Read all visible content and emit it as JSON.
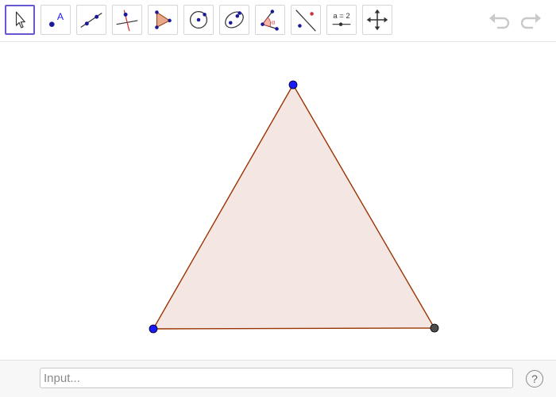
{
  "toolbar": {
    "tools": [
      {
        "name": "move-tool",
        "icon": "arrow-pointer-icon",
        "selected": true
      },
      {
        "name": "point-tool",
        "icon": "point-icon",
        "label": "A"
      },
      {
        "name": "line-tool",
        "icon": "line-icon"
      },
      {
        "name": "perpendicular-line-tool",
        "icon": "perpendicular-line-icon"
      },
      {
        "name": "polygon-tool",
        "icon": "polygon-icon"
      },
      {
        "name": "circle-tool",
        "icon": "circle-icon"
      },
      {
        "name": "ellipse-tool",
        "icon": "ellipse-icon"
      },
      {
        "name": "angle-tool",
        "icon": "angle-icon",
        "label": "α"
      },
      {
        "name": "reflect-tool",
        "icon": "reflect-icon"
      },
      {
        "name": "slider-tool",
        "icon": "slider-icon",
        "label": "a = 2"
      },
      {
        "name": "move-graphics-view-tool",
        "icon": "move-graphics-icon"
      }
    ],
    "undo_icon": "undo-icon",
    "redo_icon": "redo-icon"
  },
  "canvas": {
    "polygon_fill": "#f4e6e2",
    "polygon_stroke": "#993300",
    "free_point_color": "#1a1aff",
    "dependent_point_color": "#4d4d4d"
  },
  "input_bar": {
    "placeholder": "Input...",
    "help_label": "?"
  }
}
